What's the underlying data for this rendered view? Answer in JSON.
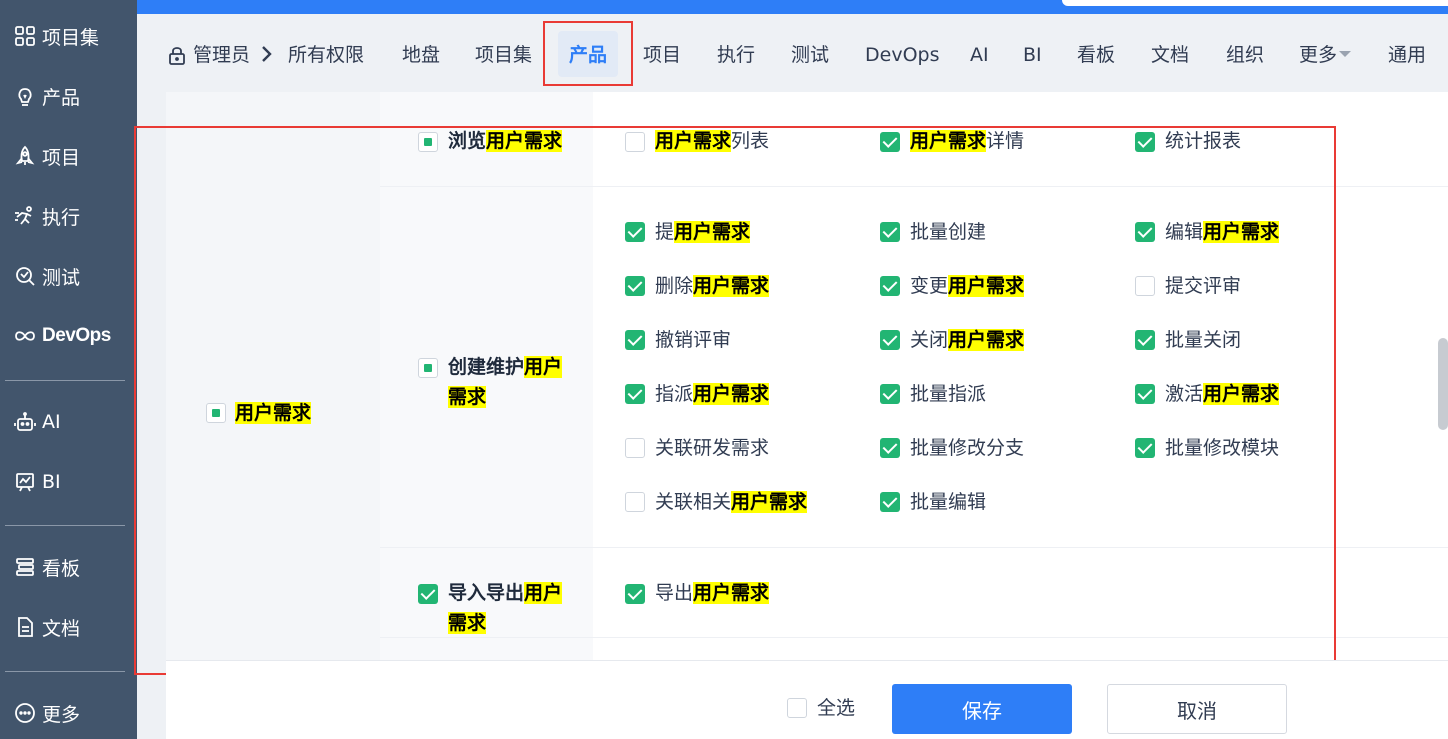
{
  "sidebar": {
    "items": [
      {
        "label": "项目集",
        "icon": "grid-icon"
      },
      {
        "label": "产品",
        "icon": "lightbulb-icon"
      },
      {
        "label": "项目",
        "icon": "rocket-icon"
      },
      {
        "label": "执行",
        "icon": "run-icon"
      },
      {
        "label": "测试",
        "icon": "bug-search-icon"
      },
      {
        "label": "DevOps",
        "icon": "infinity-icon"
      },
      {
        "label": "AI",
        "icon": "robot-icon"
      },
      {
        "label": "BI",
        "icon": "chart-board-icon"
      },
      {
        "label": "看板",
        "icon": "kanban-icon"
      },
      {
        "label": "文档",
        "icon": "document-icon"
      },
      {
        "label": "更多",
        "icon": "more-dots-icon"
      }
    ]
  },
  "nav": {
    "breadcrumb_root": "管理员",
    "breadcrumb_current": "所有权限",
    "tabs": [
      "地盘",
      "项目集",
      "产品",
      "项目",
      "执行",
      "测试",
      "DevOps",
      "AI",
      "BI",
      "看板",
      "文档",
      "组织",
      "更多",
      "通用"
    ],
    "active_tab": "产品"
  },
  "permissions": {
    "module": "用户需求",
    "groups": [
      {
        "name_pre": "浏览",
        "name_hl": "用户需求",
        "name_post": "",
        "items": [
          {
            "pre": "",
            "hl": "用户需求",
            "post": "列表",
            "checked": false
          },
          {
            "pre": "",
            "hl": "用户需求",
            "post": "详情",
            "checked": true
          },
          {
            "pre": "统计报表",
            "hl": "",
            "post": "",
            "checked": true
          }
        ]
      },
      {
        "name_pre": "创建维护",
        "name_hl": "用户",
        "name_line2": "需求",
        "items": [
          {
            "pre": "提",
            "hl": "用户需求",
            "post": "",
            "checked": true
          },
          {
            "pre": "批量创建",
            "hl": "",
            "post": "",
            "checked": true
          },
          {
            "pre": "编辑",
            "hl": "用户需求",
            "post": "",
            "checked": true
          },
          {
            "pre": "删除",
            "hl": "用户需求",
            "post": "",
            "checked": true
          },
          {
            "pre": "变更",
            "hl": "用户需求",
            "post": "",
            "checked": true
          },
          {
            "pre": "提交评审",
            "hl": "",
            "post": "",
            "checked": false
          },
          {
            "pre": "撤销评审",
            "hl": "",
            "post": "",
            "checked": true
          },
          {
            "pre": "关闭",
            "hl": "用户需求",
            "post": "",
            "checked": true
          },
          {
            "pre": "批量关闭",
            "hl": "",
            "post": "",
            "checked": true
          },
          {
            "pre": "指派",
            "hl": "用户需求",
            "post": "",
            "checked": true
          },
          {
            "pre": "批量指派",
            "hl": "",
            "post": "",
            "checked": true
          },
          {
            "pre": "激活",
            "hl": "用户需求",
            "post": "",
            "checked": true
          },
          {
            "pre": "关联研发需求",
            "hl": "",
            "post": "",
            "checked": false
          },
          {
            "pre": "批量修改分支",
            "hl": "",
            "post": "",
            "checked": true
          },
          {
            "pre": "批量修改模块",
            "hl": "",
            "post": "",
            "checked": true
          },
          {
            "pre": "关联相关",
            "hl": "用户需求",
            "post": "",
            "checked": false
          },
          {
            "pre": "批量编辑",
            "hl": "",
            "post": "",
            "checked": true
          }
        ]
      },
      {
        "name_pre": "导入导出",
        "name_hl": "用户",
        "name_line2": "需求",
        "items": [
          {
            "pre": "导出",
            "hl": "用户需求",
            "post": "",
            "checked": true
          }
        ]
      }
    ]
  },
  "footer": {
    "select_all": "全选",
    "save": "保存",
    "cancel": "取消"
  },
  "colors": {
    "sidebar_bg": "#42556c",
    "accent": "#2e7ef7",
    "check_green": "#22b573",
    "highlight": "#ffff00",
    "annotation_red": "#e93a35"
  }
}
